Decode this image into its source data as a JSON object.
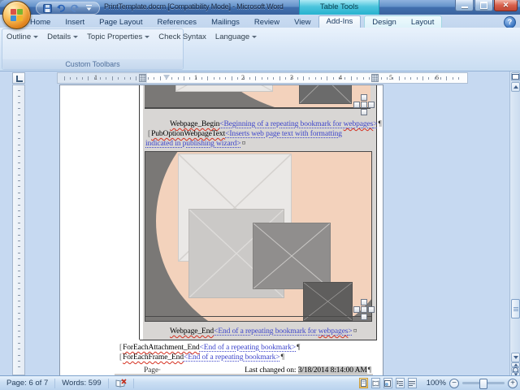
{
  "window": {
    "title": "PrintTemplate.docm [Compatibility Mode] - Microsoft Word",
    "contextual_tools_label": "Table Tools"
  },
  "quick_access": {
    "buttons": [
      "save",
      "undo",
      "redo",
      "customize-quick-access"
    ]
  },
  "ribbon_tabs": [
    {
      "label": "Home"
    },
    {
      "label": "Insert"
    },
    {
      "label": "Page Layout"
    },
    {
      "label": "References"
    },
    {
      "label": "Mailings"
    },
    {
      "label": "Review"
    },
    {
      "label": "View"
    },
    {
      "label": "Add-Ins",
      "active": true
    },
    {
      "label": "Design",
      "contextual": true
    },
    {
      "label": "Layout",
      "contextual": true
    }
  ],
  "addins_toolbar": {
    "group_label": "Custom Toolbars",
    "items": [
      {
        "label": "Outline",
        "dropdown": true
      },
      {
        "label": "Details",
        "dropdown": true
      },
      {
        "label": "Topic Properties",
        "dropdown": true
      },
      {
        "label": "Check Syntax",
        "dropdown": false
      },
      {
        "label": "Language",
        "dropdown": true
      }
    ]
  },
  "ruler": {
    "numbers": [
      "1",
      "1",
      "2",
      "3",
      "4",
      "5",
      "6"
    ]
  },
  "document_text": {
    "webpage_begin_name": "Webpage_Begin",
    "webpage_begin_desc_pre": "<Beginning of a repeating bookmark for ",
    "webpage_begin_desc_word": "webpages",
    "webpage_begin_desc_close": ">",
    "pub_option_name": "PubOptionWebpageText",
    "pub_option_desc_line1": "<Inserts web page text with formatting",
    "pub_option_desc_line2": "indicated in publishing wizard>",
    "webpage_end_name": "Webpage_End",
    "webpage_end_desc_pre": "<End of a repeating bookmark for ",
    "webpage_end_desc_word": "webpages",
    "webpage_end_desc_close": ">",
    "foreach_attachment_name": "ForEachAttachment_End",
    "foreach_attachment_desc": "<End of a repeating bookmark>",
    "foreach_frame_name": "ForEachFrame_End",
    "foreach_frame_desc": "<End of a repeating bookmark>",
    "footer_left": "Page·",
    "footer_right_label": "Last changed on: ",
    "footer_right_value": "3/18/2014 8:14:00 AM",
    "pilcrow": "¶",
    "cell_mark": "¤",
    "bookmark_bracket": "["
  },
  "status_bar": {
    "page": "Page: 6 of 7",
    "words": "Words: 599",
    "zoom_level": "100%"
  },
  "colors": {
    "contextual_accent": "#35bcd8",
    "field_shading": "#d8d6d4",
    "date_field_shading": "#c6c6c6",
    "placeholder_peach": "#f3d2bc",
    "image_background_gray": "#7a7876",
    "field_text_blue": "#3e46cb"
  }
}
